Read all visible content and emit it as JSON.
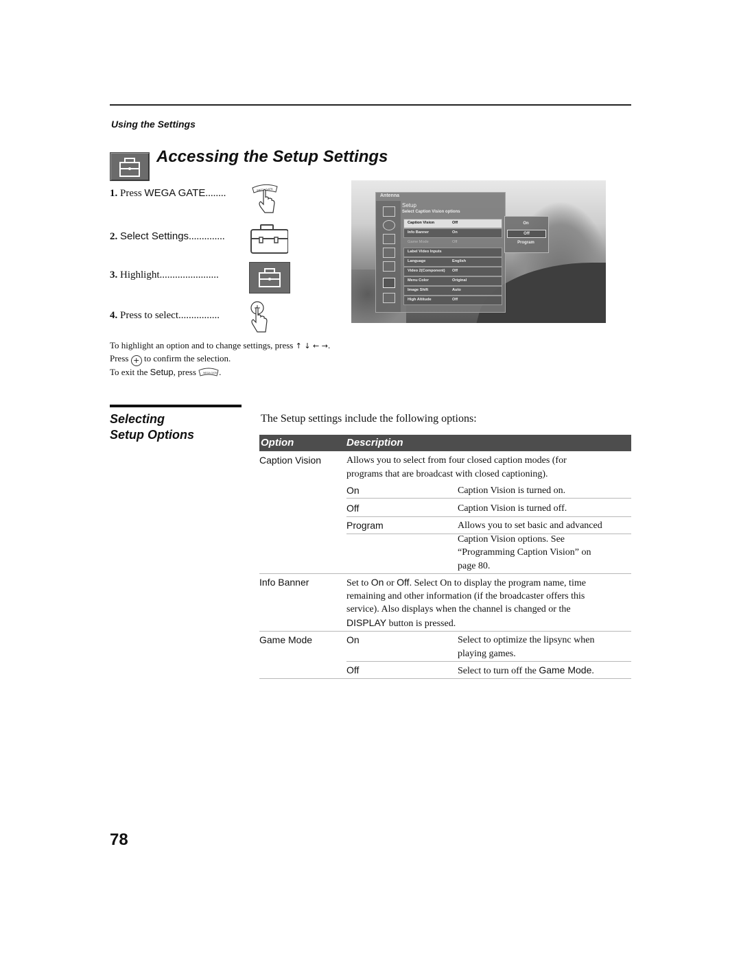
{
  "header": {
    "section_label": "Using the Settings",
    "page_title": "Accessing the Setup Settings",
    "title_icon": "toolbox-icon"
  },
  "steps": [
    {
      "num": "1.",
      "text_serif": "Press ",
      "text_sans": "WEGA GATE",
      "dots": "........",
      "icon": "wega-gate-press-icon"
    },
    {
      "num": "2.",
      "text_serif": "",
      "text_sans": "Select Settings",
      "dots": "..............",
      "icon": "toolbox-outline-icon"
    },
    {
      "num": "3.",
      "text_serif": "Highlight",
      "text_sans": "",
      "dots": ".......................",
      "icon": "toolbox-highlighted-icon"
    },
    {
      "num": "4.",
      "text_serif": "Press to select",
      "text_sans": "",
      "dots": "................",
      "icon": "select-button-press-icon"
    }
  ],
  "wega_gate_label": "WEGA GATE",
  "tv_screen": {
    "source": "Antenna",
    "menu_title": "Setup",
    "menu_subtitle": "Select Caption Vision options",
    "rows": [
      {
        "label": "Caption Vision",
        "value": "Off",
        "state": "highlighted"
      },
      {
        "label": "Info Banner",
        "value": "On",
        "state": "normal"
      },
      {
        "label": "Game Mode",
        "value": "Off",
        "state": "dimmed"
      },
      {
        "label": "Label Video Inputs",
        "value": "",
        "state": "normal"
      },
      {
        "label": "Language",
        "value": "English",
        "state": "normal"
      },
      {
        "label": "Video 2(Component)",
        "value": "Off",
        "state": "normal"
      },
      {
        "label": "Menu Color",
        "value": "Original",
        "state": "normal"
      },
      {
        "label": "Image Shift",
        "value": "Auto",
        "state": "normal"
      },
      {
        "label": "High Altitude",
        "value": "Off",
        "state": "normal"
      }
    ],
    "submenu": [
      {
        "label": "On",
        "selected": false
      },
      {
        "label": "Off",
        "selected": true
      },
      {
        "label": "Program",
        "selected": false
      }
    ]
  },
  "instructions": {
    "line1": "To highlight an option and to change settings, press",
    "arrows": "↑ ↓ ← →",
    "line1_end": ".",
    "line2_a": "Press",
    "line2_b": "to confirm the selection.",
    "line3_a": "To exit the",
    "line3_setup": "Setup",
    "line3_b": ", press",
    "line3_end": "."
  },
  "section": {
    "title_line1": "Selecting",
    "title_line2": "Setup Options",
    "intro": "The Setup settings include the following options:"
  },
  "table": {
    "headers": {
      "option": "Option",
      "description": "Description"
    },
    "caption_vision": {
      "option": "Caption Vision",
      "desc_l1": "Allows you to select from four closed caption modes (for",
      "desc_l2": "programs that are broadcast with closed captioning).",
      "sub": [
        {
          "value": "On",
          "lines": [
            "Caption Vision is turned on."
          ]
        },
        {
          "value": "Off",
          "lines": [
            "Caption Vision is turned off."
          ]
        },
        {
          "value": "Program",
          "lines": [
            "Allows you to set basic and advanced",
            "Caption Vision options. See",
            "“Programming Caption Vision” on",
            "page 80."
          ]
        }
      ]
    },
    "info_banner": {
      "option": "Info Banner",
      "l1_a": "Set to ",
      "l1_on": "On",
      "l1_b": " or ",
      "l1_off": "Off",
      "l1_c": ". Select On to display the program name, time",
      "l2": "remaining and other information (if the broadcaster offers this",
      "l3": "service). Also displays when the channel is changed or the",
      "l4_display": "DISPLAY",
      "l4_rest": " button is pressed."
    },
    "game_mode": {
      "option": "Game Mode",
      "on": "On",
      "on_l1": "Select to optimize the lipsync when",
      "on_l2": "playing games.",
      "off": "Off",
      "off_a": "Select to turn off the ",
      "off_gm": "Game Mode",
      "off_end": "."
    }
  },
  "page_number": "78"
}
